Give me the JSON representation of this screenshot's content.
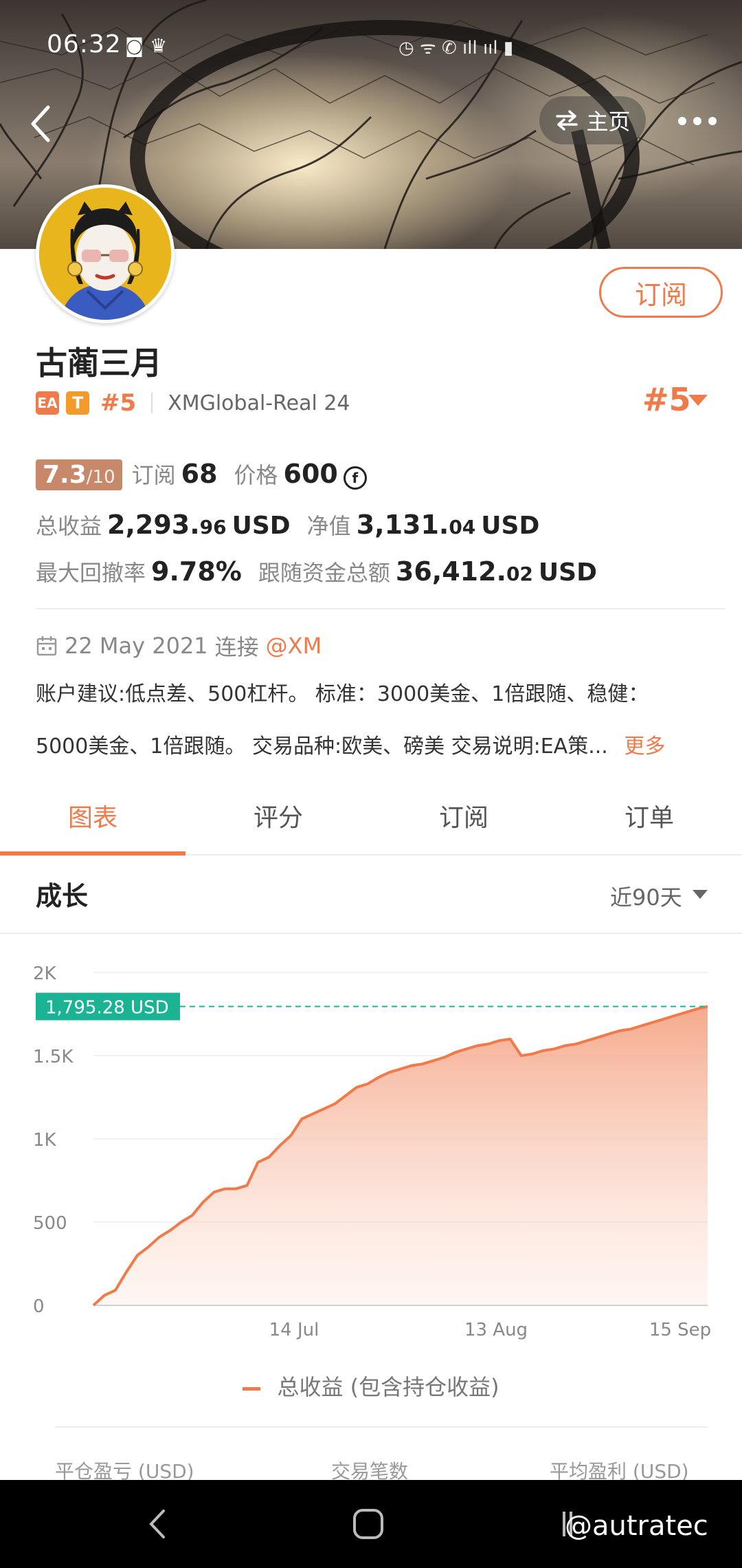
{
  "status_bar": {
    "time": "06:32"
  },
  "header": {
    "home_label": "主页"
  },
  "profile": {
    "name": "古蔺三月",
    "badge_ea": "EA",
    "badge_t": "T",
    "rank_small": "#5",
    "server": "XMGlobal-Real 24",
    "rank_big": "#5",
    "subscribe_label": "订阅"
  },
  "stats": {
    "score": "7.3",
    "score_max": "/10",
    "subs_label": "订阅",
    "subs_value": "68",
    "price_label": "价格",
    "price_value": "600",
    "price_coin": "f",
    "total_profit_label": "总收益",
    "total_profit_int": "2,293.",
    "total_profit_dec": "96",
    "total_profit_unit": "USD",
    "equity_label": "净值",
    "equity_int": "3,131.",
    "equity_dec": "04",
    "equity_unit": "USD",
    "max_dd_label": "最大回撤率",
    "max_dd_value": "9.78%",
    "follow_label": "跟随资金总额",
    "follow_int": "36,412.",
    "follow_dec": "02",
    "follow_unit": "USD"
  },
  "connect": {
    "date": "22 May 2021",
    "label": "连接",
    "broker": "@XM"
  },
  "description": {
    "line1": "账户建议:低点差、500杠杆。 标准：3000美金、1倍跟随、稳健：",
    "line2": "5000美金、1倍跟随。 交易品种:欧美、磅美 交易说明:EA策...",
    "more": "更多"
  },
  "tabs": [
    "图表",
    "评分",
    "订阅",
    "订单"
  ],
  "section": {
    "title": "成长",
    "period": "近90天"
  },
  "chart_data": {
    "type": "area",
    "title": "成长",
    "legend": [
      "总收益 (包含持仓收益)"
    ],
    "y_ticks": [
      "2K",
      "1.5K",
      "1K",
      "500",
      "0"
    ],
    "x_ticks": [
      "14 Jul",
      "13 Aug",
      "15 Sep"
    ],
    "ylim": [
      0,
      2000
    ],
    "current_label": "1,795.28 USD",
    "current_value": 1795.28,
    "series": [
      {
        "name": "总收益 (包含持仓收益)",
        "values": [
          0,
          60,
          90,
          200,
          300,
          350,
          410,
          450,
          500,
          540,
          620,
          680,
          700,
          700,
          720,
          860,
          890,
          960,
          1020,
          1120,
          1150,
          1180,
          1210,
          1260,
          1310,
          1330,
          1370,
          1400,
          1420,
          1440,
          1450,
          1470,
          1490,
          1520,
          1540,
          1560,
          1570,
          1590,
          1600,
          1500,
          1510,
          1530,
          1540,
          1560,
          1570,
          1590,
          1610,
          1630,
          1650,
          1660,
          1680,
          1700,
          1720,
          1740,
          1760,
          1780,
          1795.28
        ]
      }
    ],
    "color": "#f07a4a",
    "marker_color": "#1ab394"
  },
  "footer": {
    "col1": "平仓盈亏 (USD)",
    "col2": "交易笔数",
    "col3": "平均盈利 (USD)"
  },
  "watermark": "@autratec"
}
